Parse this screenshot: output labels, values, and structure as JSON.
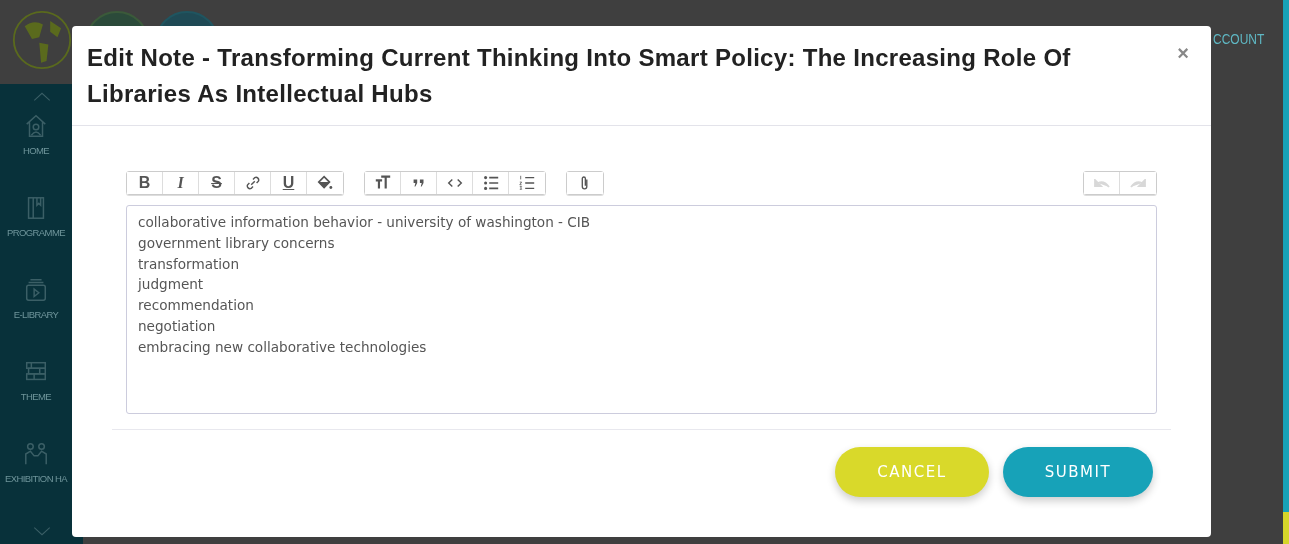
{
  "header": {
    "account_link": "CCOUNT"
  },
  "sidebar": {
    "items": [
      {
        "label": "HOME",
        "kind": "home"
      },
      {
        "label": "PROGRAMME",
        "kind": "book"
      },
      {
        "label": "E-LIBRARY",
        "kind": "video"
      },
      {
        "label": "THEME",
        "kind": "shelves"
      },
      {
        "label": "EXHIBITION HA",
        "kind": "people"
      }
    ]
  },
  "modal": {
    "title": "Edit Note - Transforming Current Thinking Into Smart Policy: The Increasing Role Of Libraries As Intellectual Hubs",
    "close": "×",
    "toolbar": [
      [
        {
          "kind": "bold",
          "label": "B",
          "disabled": false
        },
        {
          "kind": "italic",
          "label": "I",
          "disabled": false
        },
        {
          "kind": "strike",
          "label": "S",
          "disabled": false
        },
        {
          "kind": "link",
          "disabled": false
        },
        {
          "kind": "underline",
          "label": "U",
          "disabled": false
        },
        {
          "kind": "fill",
          "disabled": false
        }
      ],
      [
        {
          "kind": "heading",
          "disabled": false
        },
        {
          "kind": "quote",
          "disabled": false
        },
        {
          "kind": "code",
          "disabled": false
        },
        {
          "kind": "bullets",
          "disabled": false
        },
        {
          "kind": "numbers",
          "disabled": false
        }
      ],
      [
        {
          "kind": "attach",
          "disabled": false
        }
      ],
      [
        {
          "kind": "undo",
          "disabled": true
        },
        {
          "kind": "redo",
          "disabled": true
        }
      ]
    ],
    "editor_lines": [
      "collaborative information behavior - university of washington - CIB",
      "government library concerns",
      "transformation",
      "judgment",
      "recommendation",
      "negotiation",
      "embracing new collaborative technologies"
    ],
    "buttons": [
      {
        "kind": "cancel",
        "label": "CANCEL"
      },
      {
        "kind": "submit",
        "label": "SUBMIT"
      }
    ]
  }
}
